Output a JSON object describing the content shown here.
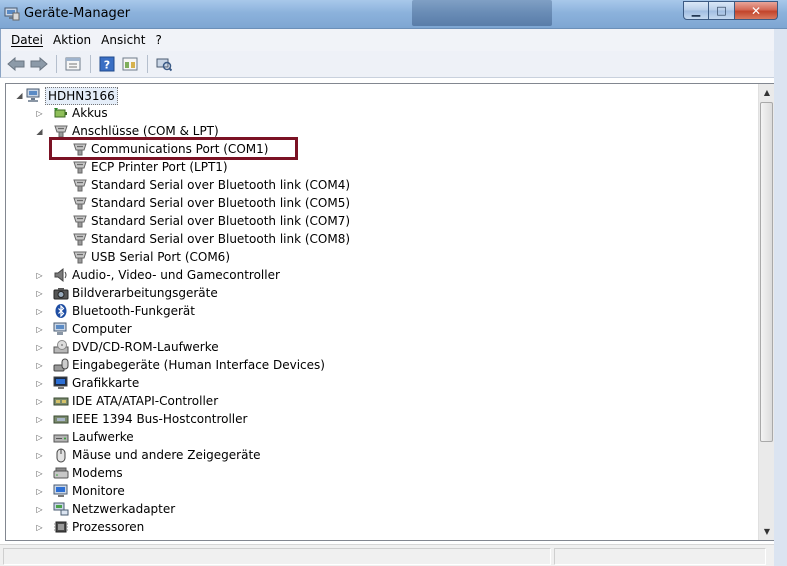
{
  "window": {
    "title": "Geräte-Manager",
    "min_symbol": "▁",
    "max_symbol": "□",
    "close_symbol": "✕"
  },
  "menu": [
    {
      "label": "Datei",
      "hotkey": "D"
    },
    {
      "label": "Aktion",
      "hotkey": "k"
    },
    {
      "label": "Ansicht",
      "hotkey": "A"
    },
    {
      "label": "?",
      "hotkey": "?"
    }
  ],
  "toolbar": [
    {
      "name": "back-icon"
    },
    {
      "name": "forward-icon"
    },
    {
      "name": "properties-icon"
    },
    {
      "name": "help-icon"
    },
    {
      "name": "view-icon"
    },
    {
      "name": "scan-hardware-icon"
    }
  ],
  "tree": {
    "root": {
      "label": "HDHN3166",
      "icon": "computer-icon",
      "expanded": true
    },
    "items": [
      {
        "label": "Akkus",
        "icon": "battery-icon",
        "level": 1,
        "expander": "collapsed"
      },
      {
        "label": "Anschlüsse (COM & LPT)",
        "icon": "port-icon",
        "level": 1,
        "expander": "expanded"
      },
      {
        "label": "Communications Port (COM1)",
        "icon": "port-icon",
        "level": 2,
        "expander": "none",
        "highlighted": true
      },
      {
        "label": "ECP Printer Port (LPT1)",
        "icon": "port-icon",
        "level": 2,
        "expander": "none"
      },
      {
        "label": "Standard Serial over Bluetooth link (COM4)",
        "icon": "port-icon",
        "level": 2,
        "expander": "none"
      },
      {
        "label": "Standard Serial over Bluetooth link (COM5)",
        "icon": "port-icon",
        "level": 2,
        "expander": "none"
      },
      {
        "label": "Standard Serial over Bluetooth link (COM7)",
        "icon": "port-icon",
        "level": 2,
        "expander": "none"
      },
      {
        "label": "Standard Serial over Bluetooth link (COM8)",
        "icon": "port-icon",
        "level": 2,
        "expander": "none"
      },
      {
        "label": "USB Serial Port (COM6)",
        "icon": "port-icon",
        "level": 2,
        "expander": "none"
      },
      {
        "label": "Audio-, Video- und Gamecontroller",
        "icon": "speaker-icon",
        "level": 1,
        "expander": "collapsed"
      },
      {
        "label": "Bildverarbeitungsgeräte",
        "icon": "camera-icon",
        "level": 1,
        "expander": "collapsed"
      },
      {
        "label": "Bluetooth-Funkgerät",
        "icon": "bluetooth-icon",
        "level": 1,
        "expander": "collapsed"
      },
      {
        "label": "Computer",
        "icon": "computer-icon",
        "level": 1,
        "expander": "collapsed"
      },
      {
        "label": "DVD/CD-ROM-Laufwerke",
        "icon": "dvd-drive-icon",
        "level": 1,
        "expander": "collapsed"
      },
      {
        "label": "Eingabegeräte (Human Interface Devices)",
        "icon": "hid-icon",
        "level": 1,
        "expander": "collapsed"
      },
      {
        "label": "Grafikkarte",
        "icon": "display-adapter-icon",
        "level": 1,
        "expander": "collapsed"
      },
      {
        "label": "IDE ATA/ATAPI-Controller",
        "icon": "ide-controller-icon",
        "level": 1,
        "expander": "collapsed"
      },
      {
        "label": "IEEE 1394 Bus-Hostcontroller",
        "icon": "firewire-icon",
        "level": 1,
        "expander": "collapsed"
      },
      {
        "label": "Laufwerke",
        "icon": "disk-drive-icon",
        "level": 1,
        "expander": "collapsed"
      },
      {
        "label": "Mäuse und andere Zeigegeräte",
        "icon": "mouse-icon",
        "level": 1,
        "expander": "collapsed"
      },
      {
        "label": "Modems",
        "icon": "modem-icon",
        "level": 1,
        "expander": "collapsed"
      },
      {
        "label": "Monitore",
        "icon": "monitor-icon",
        "level": 1,
        "expander": "collapsed"
      },
      {
        "label": "Netzwerkadapter",
        "icon": "network-adapter-icon",
        "level": 1,
        "expander": "collapsed"
      },
      {
        "label": "Prozessoren",
        "icon": "processor-icon",
        "level": 1,
        "expander": "collapsed"
      }
    ]
  },
  "colors": {
    "highlight_border": "#7b1224",
    "titlebar": "#8cb2dc"
  }
}
